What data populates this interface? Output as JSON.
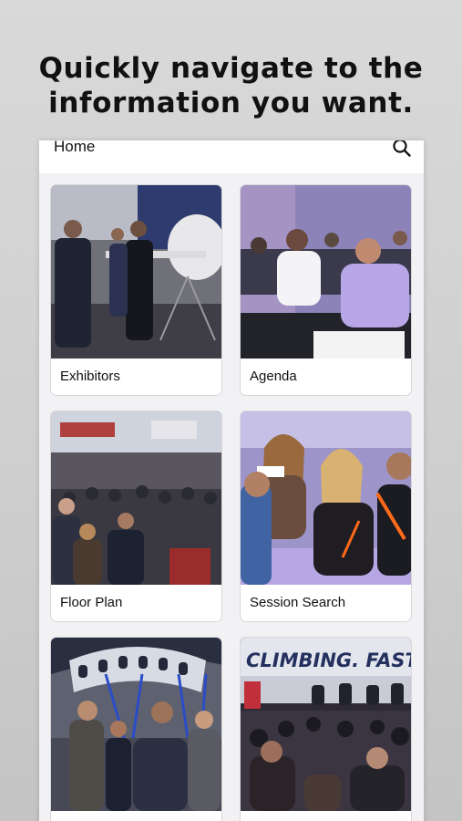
{
  "headline": {
    "line1": "Quickly navigate to the",
    "line2": "information you want."
  },
  "navbar": {
    "title": "Home",
    "search_icon": "search-icon"
  },
  "tiles": [
    {
      "label": "Exhibitors",
      "photo": "aircraft-model-exhibit-photo"
    },
    {
      "label": "Agenda",
      "photo": "conference-attendees-seated-photo"
    },
    {
      "label": "Floor Plan",
      "photo": "exhibit-hall-crowd-photo"
    },
    {
      "label": "Session Search",
      "photo": "audience-listening-photo"
    },
    {
      "label": "",
      "photo": "fuselage-display-networking-photo"
    },
    {
      "label": "",
      "photo": "climbing-fast-banner-session-photo",
      "banner_text": "CLIMBING. FAST."
    }
  ]
}
